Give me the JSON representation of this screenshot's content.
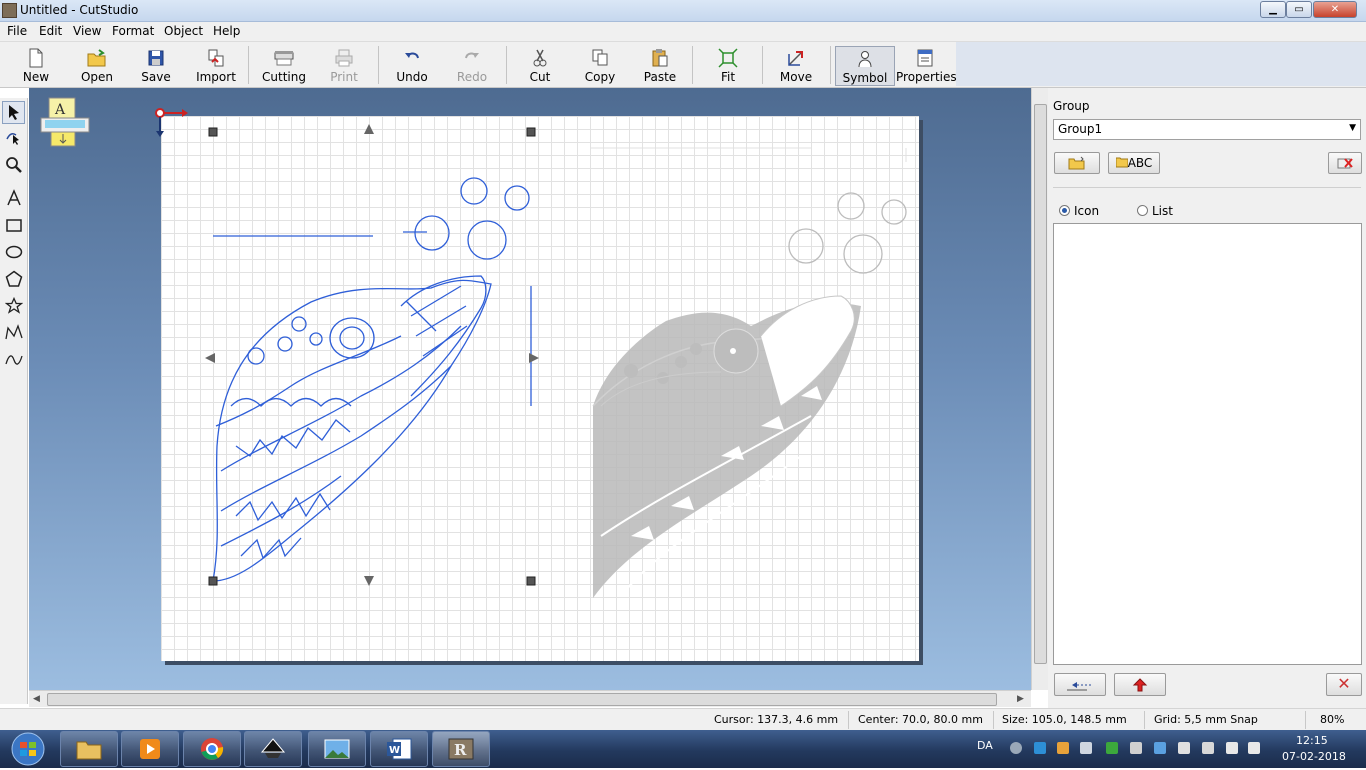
{
  "window": {
    "title": "Untitled - CutStudio",
    "min_label": "▁",
    "max_label": "▭",
    "close_label": "✕"
  },
  "menu": [
    "File",
    "Edit",
    "View",
    "Format",
    "Object",
    "Help"
  ],
  "toolbar": [
    {
      "label": "New",
      "icon": "new-document-icon",
      "enabled": true
    },
    {
      "label": "Open",
      "icon": "open-folder-icon",
      "enabled": true
    },
    {
      "label": "Save",
      "icon": "save-disk-icon",
      "enabled": true
    },
    {
      "label": "Import",
      "icon": "import-icon",
      "enabled": true
    },
    {
      "label": "Cutting",
      "icon": "cutting-plotter-icon",
      "enabled": true
    },
    {
      "label": "Print",
      "icon": "printer-icon",
      "enabled": false
    },
    {
      "label": "Undo",
      "icon": "undo-icon",
      "enabled": true
    },
    {
      "label": "Redo",
      "icon": "redo-icon",
      "enabled": false
    },
    {
      "label": "Cut",
      "icon": "scissors-icon",
      "enabled": true
    },
    {
      "label": "Copy",
      "icon": "copy-icon",
      "enabled": true
    },
    {
      "label": "Paste",
      "icon": "paste-icon",
      "enabled": true
    },
    {
      "label": "Fit",
      "icon": "fit-icon",
      "enabled": true
    },
    {
      "label": "Move",
      "icon": "move-icon",
      "enabled": true
    },
    {
      "label": "Symbol",
      "icon": "symbol-person-icon",
      "enabled": true,
      "pressed": true
    },
    {
      "label": "Properties",
      "icon": "properties-icon",
      "enabled": true
    }
  ],
  "left_tools": [
    "select-arrow-icon",
    "edit-points-icon",
    "zoom-icon",
    "text-tool-icon",
    "rectangle-icon",
    "ellipse-icon",
    "polygon-icon",
    "star-icon",
    "polyline-icon",
    "curve-icon"
  ],
  "panel": {
    "group_label": "Group",
    "group_value": "Group1",
    "add_text_button": "ABC",
    "view_modes": [
      {
        "label": "Icon",
        "selected": true
      },
      {
        "label": "List",
        "selected": false
      }
    ]
  },
  "status": {
    "cursor": "Cursor: 137.3, 4.6 mm",
    "center": "Center: 70.0, 80.0 mm",
    "size": "Size: 105.0, 148.5 mm",
    "grid": "Grid: 5,5 mm Snap",
    "zoom": "80%"
  },
  "taskbar": {
    "apps": [
      "explorer-icon",
      "media-player-icon",
      "chrome-icon",
      "inkscape-icon",
      "photo-viewer-icon",
      "word-icon",
      "cutstudio-icon"
    ],
    "language": "DA",
    "time": "12:15",
    "date": "07-02-2018"
  },
  "colors": {
    "selected_outline": "#2f5fd8",
    "preview_fill": "#b9b9b9",
    "accent": "#2a5aa8"
  }
}
